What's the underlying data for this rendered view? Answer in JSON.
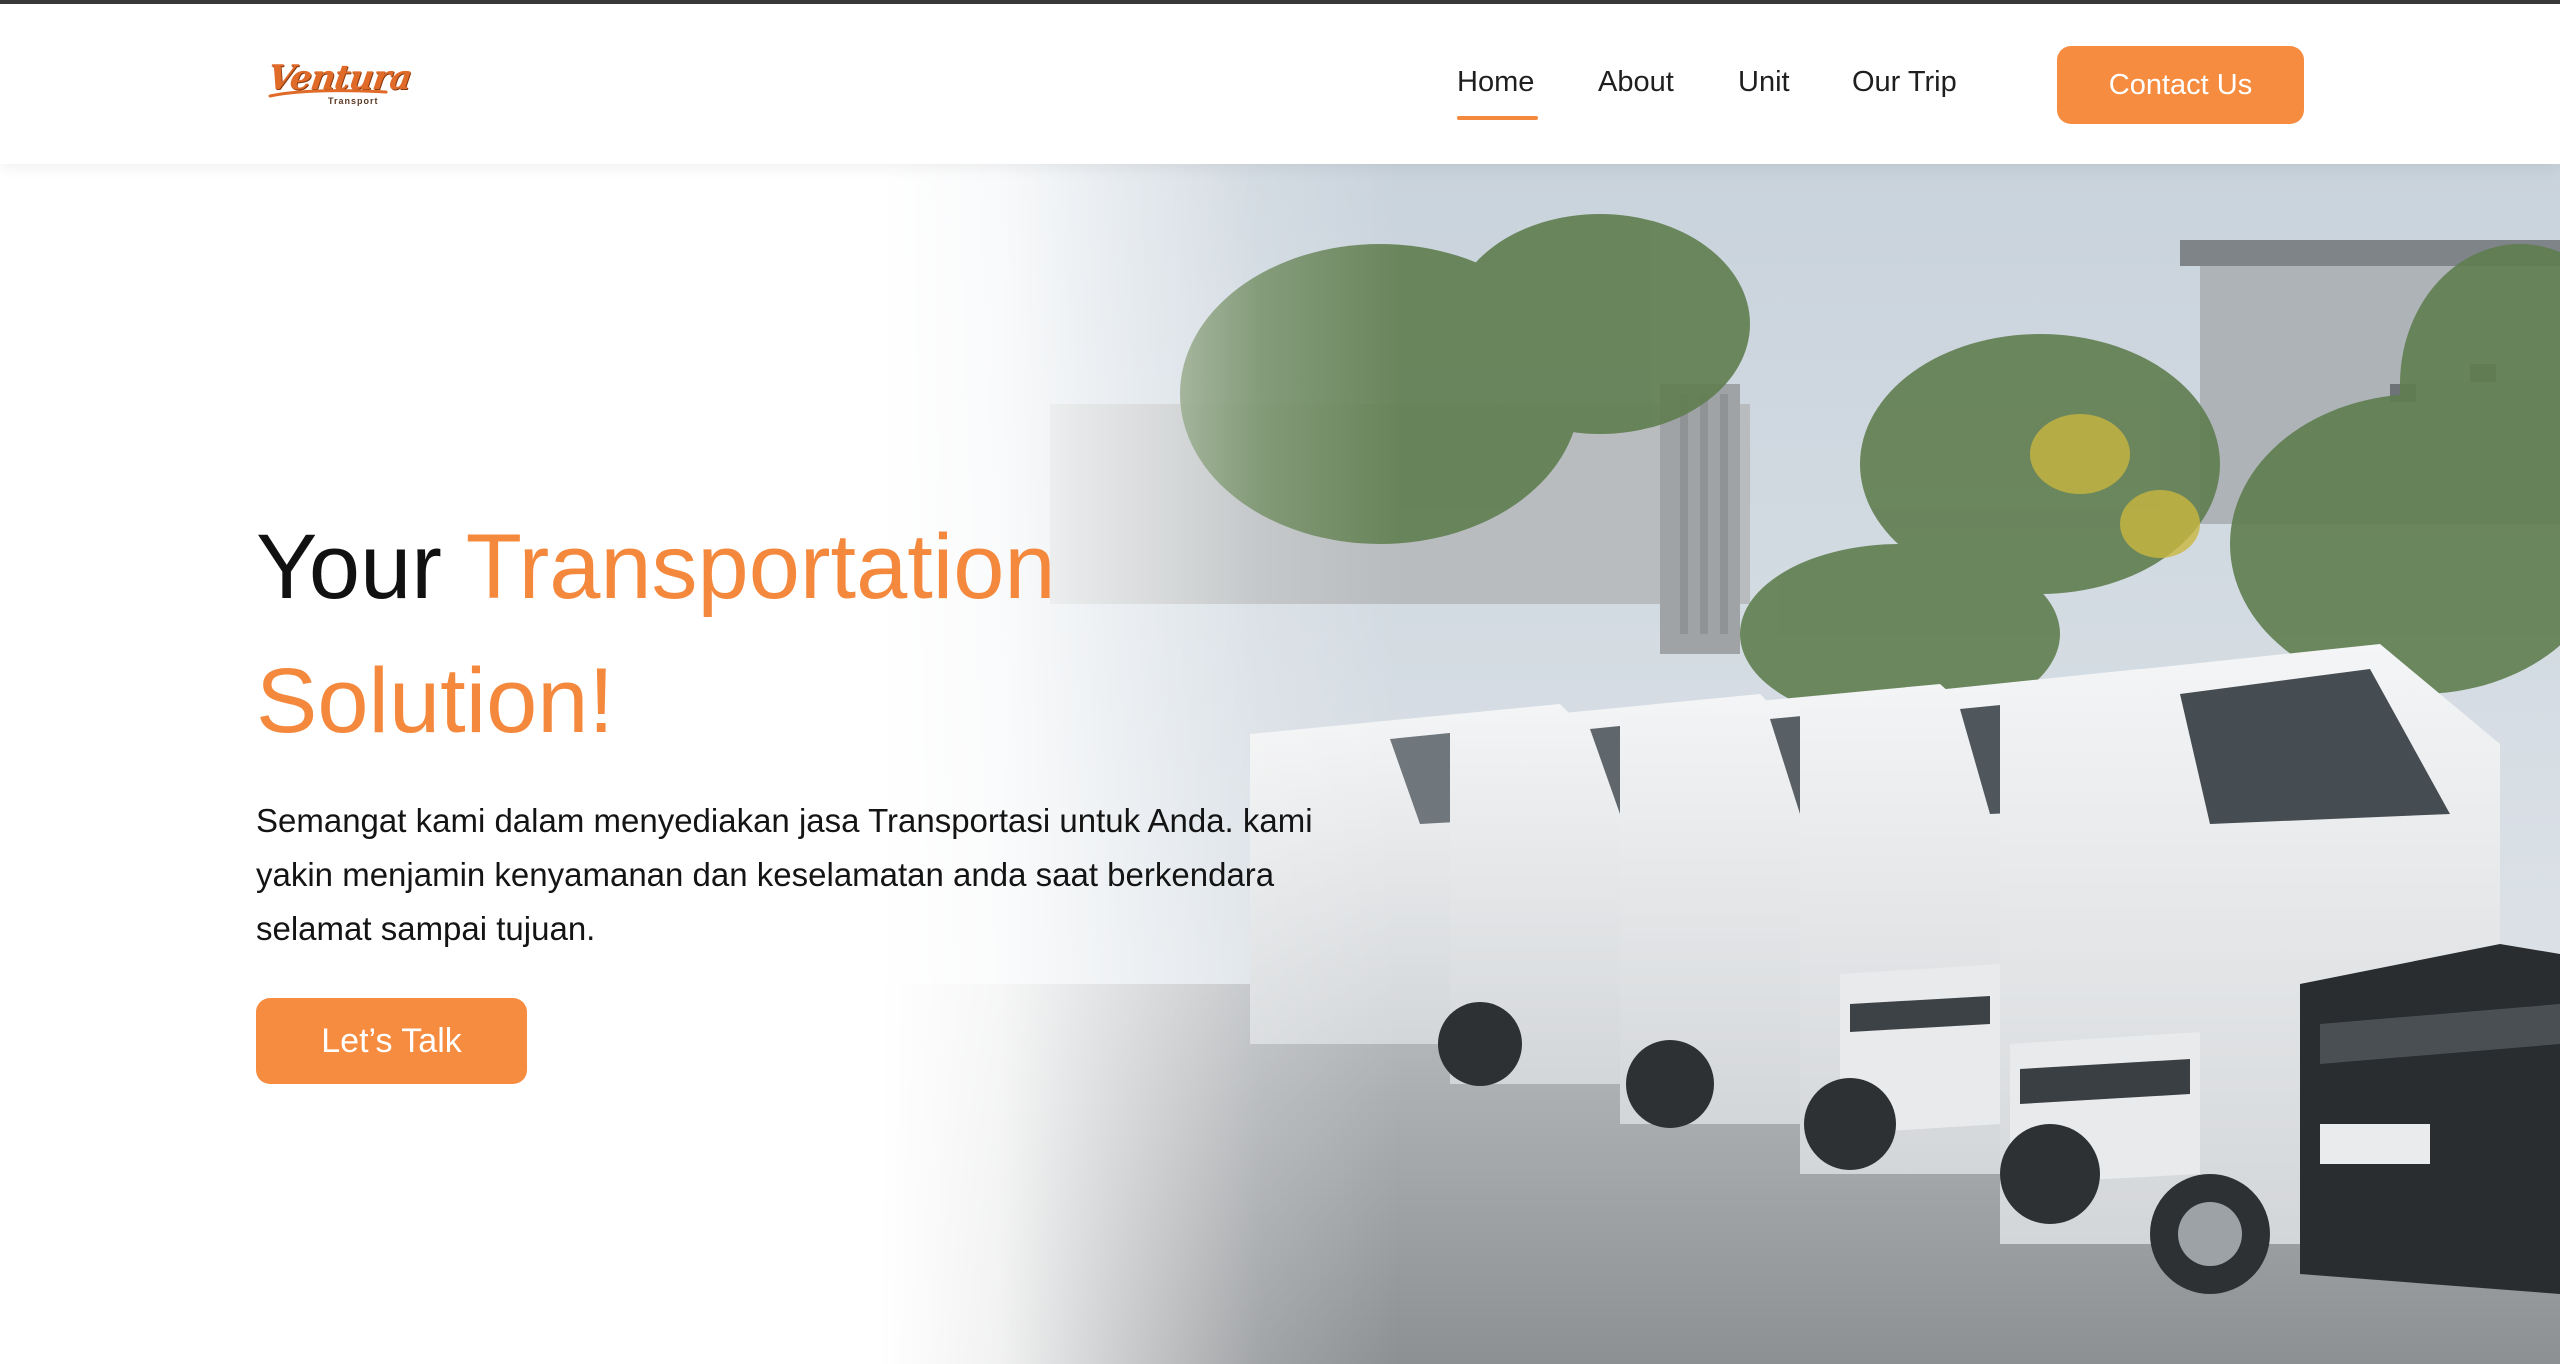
{
  "brand": {
    "logo_text": "Ventura",
    "logo_subtext": "Transport"
  },
  "nav": {
    "items": [
      {
        "label": "Home",
        "active": true
      },
      {
        "label": "About"
      },
      {
        "label": "Unit"
      },
      {
        "label": "Our Trip"
      }
    ],
    "contact_label": "Contact Us"
  },
  "hero": {
    "title_part1": "Your",
    "title_part2": "Transportation Solution!",
    "description": "Semangat kami dalam menyediakan jasa Transportasi untuk Anda. kami yakin menjamin kenyamanan dan keselamatan anda saat berkendara selamat sampai tujuan.",
    "cta_label": "Let’s Talk"
  },
  "colors": {
    "accent": "#f4893e",
    "button": "#f68c40",
    "text": "#111111"
  }
}
